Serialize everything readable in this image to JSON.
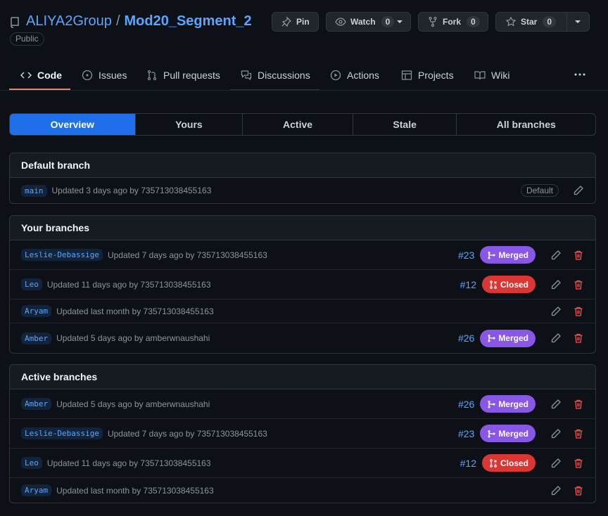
{
  "repo": {
    "owner": "ALIYA2Group",
    "separator": "/",
    "name": "Mod20_Segment_2",
    "visibility": "Public"
  },
  "header_buttons": {
    "pin": "Pin",
    "watch": {
      "label": "Watch",
      "count": "0"
    },
    "fork": {
      "label": "Fork",
      "count": "0"
    },
    "star": {
      "label": "Star",
      "count": "0"
    }
  },
  "tabs": [
    {
      "label": "Code",
      "icon": "code-icon",
      "active": true
    },
    {
      "label": "Issues",
      "icon": "issue-icon"
    },
    {
      "label": "Pull requests",
      "icon": "git-pull-request-icon"
    },
    {
      "label": "Discussions",
      "icon": "comment-discussion-icon"
    },
    {
      "label": "Actions",
      "icon": "play-icon"
    },
    {
      "label": "Projects",
      "icon": "table-icon"
    },
    {
      "label": "Wiki",
      "icon": "book-icon"
    }
  ],
  "subnav": [
    "Overview",
    "Yours",
    "Active",
    "Stale",
    "All branches"
  ],
  "default_branch": {
    "title": "Default branch",
    "row": {
      "branch": "main",
      "meta": "Updated 3 days ago by 735713038455163",
      "badge": "Default"
    }
  },
  "your_branches": {
    "title": "Your branches",
    "rows": [
      {
        "branch": "Leslie-Debassige",
        "meta": "Updated 7 days ago by 735713038455163",
        "pr": "#23",
        "state": "Merged"
      },
      {
        "branch": "Leo",
        "meta": "Updated 11 days ago by 735713038455163",
        "pr": "#12",
        "state": "Closed"
      },
      {
        "branch": "Aryam",
        "meta": "Updated last month by 735713038455163",
        "pr": "",
        "state": ""
      },
      {
        "branch": "Amber",
        "meta": "Updated 5 days ago by amberwnaushahi",
        "pr": "#26",
        "state": "Merged"
      }
    ]
  },
  "active_branches": {
    "title": "Active branches",
    "rows": [
      {
        "branch": "Amber",
        "meta": "Updated 5 days ago by amberwnaushahi",
        "pr": "#26",
        "state": "Merged"
      },
      {
        "branch": "Leslie-Debassige",
        "meta": "Updated 7 days ago by 735713038455163",
        "pr": "#23",
        "state": "Merged"
      },
      {
        "branch": "Leo",
        "meta": "Updated 11 days ago by 735713038455163",
        "pr": "#12",
        "state": "Closed"
      },
      {
        "branch": "Aryam",
        "meta": "Updated last month by 735713038455163",
        "pr": "",
        "state": ""
      }
    ]
  },
  "colors": {
    "background": "#0d1117",
    "link": "#58a6ff",
    "merged": "#8957e5",
    "closed": "#da3633",
    "delete": "#f85149",
    "tab_underline": "#f78166",
    "selected": "#1f6feb"
  }
}
